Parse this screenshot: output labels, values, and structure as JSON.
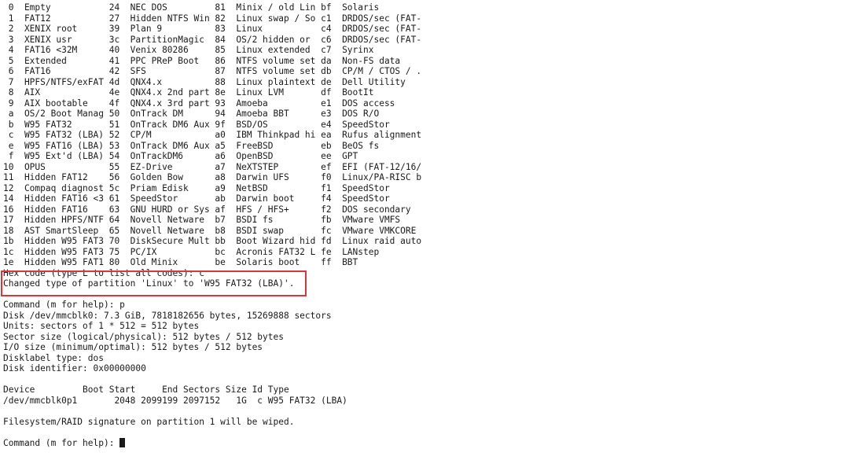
{
  "partition_table": [
    "0  Empty           24  NEC DOS         81  Minix / old Lin bf  Solaris",
    "1  FAT12           27  Hidden NTFS Win 82  Linux swap / So c1  DRDOS/sec (FAT-",
    "2  XENIX root      39  Plan 9          83  Linux           c4  DRDOS/sec (FAT-",
    "3  XENIX usr       3c  PartitionMagic  84  OS/2 hidden or  c6  DRDOS/sec (FAT-",
    "4  FAT16 <32M      40  Venix 80286     85  Linux extended  c7  Syrinx",
    "5  Extended        41  PPC PReP Boot   86  NTFS volume set da  Non-FS data",
    "6  FAT16           42  SFS             87  NTFS volume set db  CP/M / CTOS / .",
    "7  HPFS/NTFS/exFAT 4d  QNX4.x          88  Linux plaintext de  Dell Utility",
    "8  AIX             4e  QNX4.x 2nd part 8e  Linux LVM       df  BootIt",
    "9  AIX bootable    4f  QNX4.x 3rd part 93  Amoeba          e1  DOS access",
    "a  OS/2 Boot Manag 50  OnTrack DM      94  Amoeba BBT      e3  DOS R/O",
    "b  W95 FAT32       51  OnTrack DM6 Aux 9f  BSD/OS          e4  SpeedStor",
    "c  W95 FAT32 (LBA) 52  CP/M            a0  IBM Thinkpad hi ea  Rufus alignment",
    "e  W95 FAT16 (LBA) 53  OnTrack DM6 Aux a5  FreeBSD         eb  BeOS fs",
    "f  W95 Ext'd (LBA) 54  OnTrackDM6      a6  OpenBSD         ee  GPT",
    "10  OPUS            55  EZ-Drive        a7  NeXTSTEP        ef  EFI (FAT-12/16/",
    "11  Hidden FAT12    56  Golden Bow      a8  Darwin UFS      f0  Linux/PA-RISC b",
    "12  Compaq diagnost 5c  Priam Edisk     a9  NetBSD          f1  SpeedStor",
    "14  Hidden FAT16 <3 61  SpeedStor       ab  Darwin boot     f4  SpeedStor",
    "16  Hidden FAT16    63  GNU HURD or Sys af  HFS / HFS+      f2  DOS secondary",
    "17  Hidden HPFS/NTF 64  Novell Netware  b7  BSDI fs         fb  VMware VMFS",
    "18  AST SmartSleep  65  Novell Netware  b8  BSDI swap       fc  VMware VMKCORE",
    "1b  Hidden W95 FAT3 70  DiskSecure Mult bb  Boot Wizard hid fd  Linux raid auto",
    "1c  Hidden W95 FAT3 75  PC/IX           bc  Acronis FAT32 L fe  LANstep",
    "1e  Hidden W95 FAT1 80  Old Minix       be  Solaris boot    ff  BBT"
  ],
  "highlighted": {
    "hex_prompt": "Hex code (type L to list all codes): c",
    "changed_msg": "Changed type of partition 'Linux' to 'W95 FAT32 (LBA)'."
  },
  "session": {
    "cmd_p": "Command (m for help): p",
    "disk": "Disk /dev/mmcblk0: 7.3 GiB, 7818182656 bytes, 15269888 sectors",
    "units": "Units: sectors of 1 * 512 = 512 bytes",
    "sector_size": "Sector size (logical/physical): 512 bytes / 512 bytes",
    "io_size": "I/O size (minimum/optimal): 512 bytes / 512 bytes",
    "disklabel": "Disklabel type: dos",
    "identifier": "Disk identifier: 0x00000000",
    "table_header": "Device         Boot Start     End Sectors Size Id Type",
    "table_row": "/dev/mmcblk0p1       2048 2099199 2097152   1G  c W95 FAT32 (LBA)",
    "wipe_msg": "Filesystem/RAID signature on partition 1 will be wiped.",
    "final_prompt": "Command (m for help): "
  }
}
